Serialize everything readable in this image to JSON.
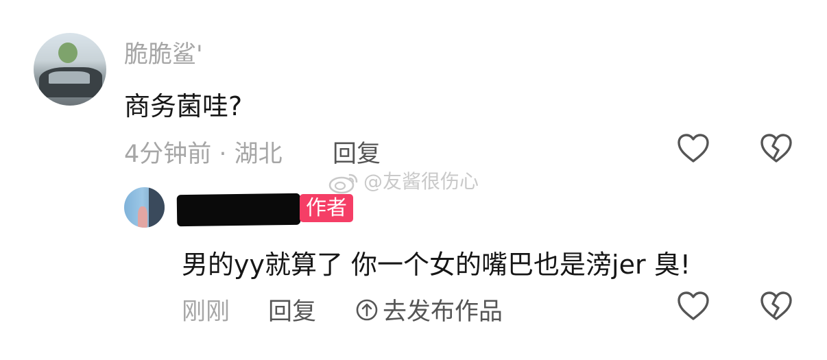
{
  "comment": {
    "username": "脆脆鲨'",
    "text": "商务菌哇?",
    "time_location": "4分钟前 · 湖北",
    "reply_label": "回复",
    "avatar_icon": "avatar-photo-car"
  },
  "watermark": {
    "text": "@友酱很伤心",
    "icon": "weibo-logo-icon"
  },
  "reply": {
    "username": "",
    "author_badge": "作者",
    "text": "男的yy就算了 你一个女的嘴巴也是滂jer 臭!",
    "time": "刚刚",
    "reply_label": "回复",
    "publish_label": "去发布作品",
    "publish_icon": "arrow-up-circle-icon",
    "avatar_icon": "avatar-photo-window"
  },
  "icons": {
    "like": "heart-outline-icon",
    "dislike": "broken-heart-icon"
  },
  "colors": {
    "badge": "#f53e66",
    "meta_gray": "#a6a6a6",
    "action_gray": "#555555",
    "text_black": "#161616"
  }
}
